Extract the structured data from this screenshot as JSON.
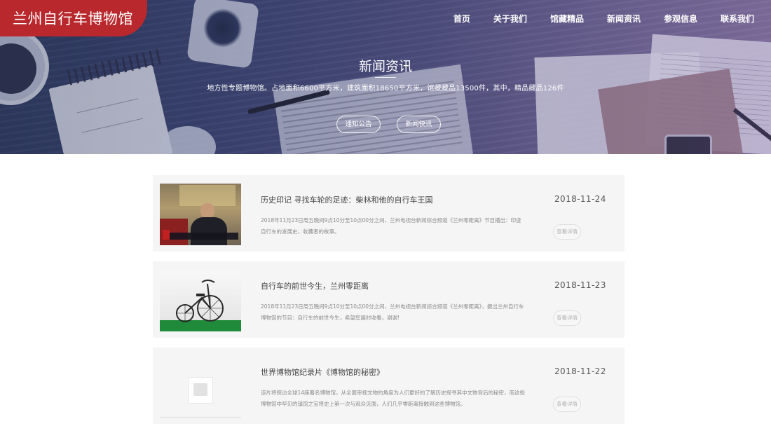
{
  "site": {
    "logo_text": "兰州自行车博物馆"
  },
  "nav": {
    "items": [
      {
        "label": "首页"
      },
      {
        "label": "关于我们"
      },
      {
        "label": "馆藏精品"
      },
      {
        "label": "新闻资讯"
      },
      {
        "label": "参观信息"
      },
      {
        "label": "联系我们"
      }
    ]
  },
  "hero": {
    "title": "新闻资讯",
    "subtitle": "地方性专题博物馆。占地面积6600平方米，建筑面积18650平方米，馆藏藏品13500件，其中，精品藏品126件",
    "buttons": [
      {
        "label": "通知公告"
      },
      {
        "label": "新闻快讯"
      }
    ]
  },
  "news": [
    {
      "title": "历史印记 寻找车轮的足迹：柴林和他的自行车王国",
      "desc": "2018年11月23日周五晚间9点10分至10点00分之间，兰州电视台新闻综合频道《兰州零距离》节目播出：印迹自行车的发展史，收藏者的故事。",
      "date": "2018-11-24",
      "more": "查看详情",
      "thumb": "person-photo"
    },
    {
      "title": "自行车的前世今生，兰州零距离",
      "desc": "2018年11月23日周五晚间9点10分至10点00分之间，兰州电视台新闻综合频道《兰州零距离》，摄出兰州自行车博物馆的节目：自行车的前世今生，希望您届时收看，谢谢!",
      "date": "2018-11-23",
      "more": "查看详情",
      "thumb": "bicycle-photo"
    },
    {
      "title": "世界博物馆纪录片《博物馆的秘密》",
      "desc": "该片将探访全球14座著名博物馆，从全面审视文物的角度为人们更好的了解历史探寻其中文物背后的秘密，而这些博物馆中罕见的镇馆之宝将史上第一次与观众见面，人们几乎零距离接触到这些博物馆。",
      "date": "2018-11-22",
      "more": "查看详情",
      "thumb": "image-placeholder"
    }
  ],
  "colors": {
    "logo_bg": "#b8282d",
    "card_bg": "#f5f5f5",
    "hero_tint": "#51527f"
  }
}
